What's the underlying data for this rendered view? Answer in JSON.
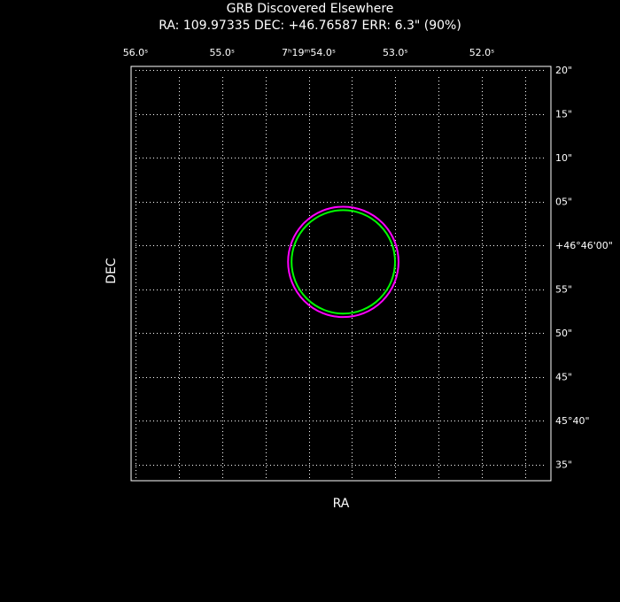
{
  "chart_data": {
    "type": "scatter",
    "title": "GRB Discovered Elsewhere",
    "subtitle": "RA: 109.97335   DEC: +46.76587   ERR: 6.3\" (90%)",
    "xlabel": "RA",
    "ylabel": "DEC",
    "grid": true,
    "colors": {
      "background": "#000000",
      "frame": "#ffffff",
      "grid": "#ffffff",
      "outer_circle": "#ff00ff",
      "inner_circle": "#00ff00"
    },
    "ra_ticks": [
      {
        "value": 56.0,
        "label": "56.0ˢ"
      },
      {
        "value": 55.0,
        "label": "55.0ˢ"
      },
      {
        "value": 54.0,
        "label": "7ʰ19ᵐ54.0ˢ"
      },
      {
        "value": 53.0,
        "label": "53.0ˢ"
      },
      {
        "value": 52.0,
        "label": "52.0ˢ"
      }
    ],
    "dec_ticks": [
      {
        "value": 20,
        "label": "20\""
      },
      {
        "value": 15,
        "label": "15\""
      },
      {
        "value": 10,
        "label": "10\""
      },
      {
        "value": 5,
        "label": "05\""
      },
      {
        "value": 0,
        "label": "+46°46'00\""
      },
      {
        "value": -5,
        "label": "55\""
      },
      {
        "value": -10,
        "label": "50\""
      },
      {
        "value": -15,
        "label": "45\""
      },
      {
        "value": -20,
        "label": "45°40\""
      },
      {
        "value": -25,
        "label": "35\""
      }
    ],
    "circles": [
      {
        "name": "error-circle-outer",
        "ra_sec": 53.6,
        "dec_arcsec": -1.9,
        "radius_arcsec": 6.3,
        "color": "#ff00ff"
      },
      {
        "name": "error-circle-inner",
        "ra_sec": 53.6,
        "dec_arcsec": -1.9,
        "radius_arcsec": 5.9,
        "color": "#00ff00"
      }
    ]
  }
}
